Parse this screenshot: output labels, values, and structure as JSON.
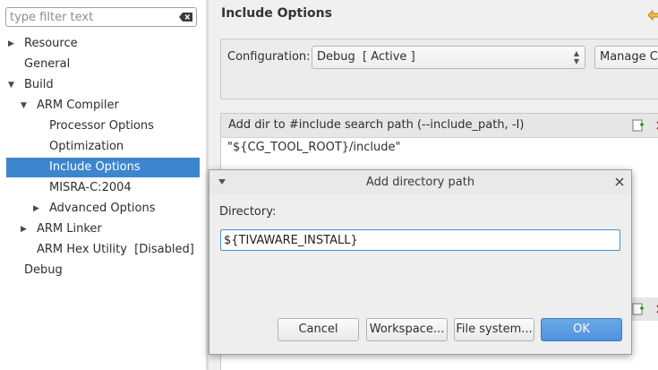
{
  "filter": {
    "placeholder": "type filter text",
    "value": ""
  },
  "tree": [
    {
      "label": "Resource",
      "expander": "collapsed"
    },
    {
      "label": "General",
      "expander": "none"
    },
    {
      "label": "Build",
      "expander": "expanded"
    },
    {
      "label": "ARM Compiler",
      "expander": "expanded"
    },
    {
      "label": "Processor Options",
      "expander": "none"
    },
    {
      "label": "Optimization",
      "expander": "none"
    },
    {
      "label": "Include Options",
      "expander": "none",
      "selected": true
    },
    {
      "label": "MISRA-C:2004",
      "expander": "none"
    },
    {
      "label": "Advanced Options",
      "expander": "collapsed"
    },
    {
      "label": "ARM Linker",
      "expander": "collapsed"
    },
    {
      "label": "ARM Hex Utility  [Disabled]",
      "expander": "none"
    },
    {
      "label": "Debug",
      "expander": "none"
    }
  ],
  "page": {
    "title": "Include Options",
    "configuration_label": "Configuration:",
    "configuration_value": "Debug  [ Active ]",
    "manage_button": "Manage Co",
    "include_section_title": "Add dir to #include search path (--include_path, -I)",
    "include_paths": [
      "\"${CG_TOOL_ROOT}/include\""
    ]
  },
  "dialog": {
    "title": "Add directory path",
    "directory_label": "Directory:",
    "directory_value": "${TIVAWARE_INSTALL}",
    "buttons": {
      "cancel": "Cancel",
      "workspace": "Workspace...",
      "file_system": "File system...",
      "ok": "OK"
    }
  },
  "colors": {
    "selection": "#3d86cf",
    "ok_button": "#4f92dd",
    "panel_bg": "#f0f0f0",
    "add_icon": "#3a9a3a",
    "delete_icon": "#cc2222"
  }
}
